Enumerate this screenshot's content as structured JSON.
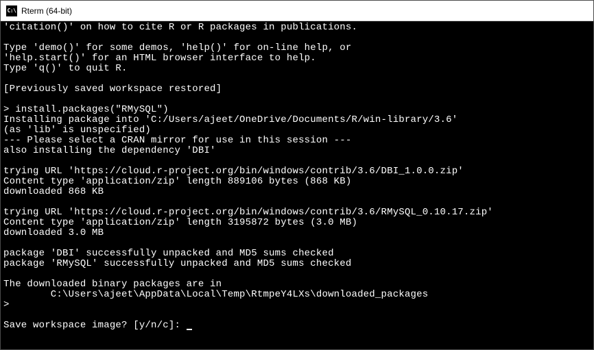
{
  "window": {
    "title": "Rterm (64-bit)",
    "icon_label": "C:\\"
  },
  "terminal": {
    "lines": [
      "'citation()' on how to cite R or R packages in publications.",
      "",
      "Type 'demo()' for some demos, 'help()' for on-line help, or",
      "'help.start()' for an HTML browser interface to help.",
      "Type 'q()' to quit R.",
      "",
      "[Previously saved workspace restored]",
      "",
      "> install.packages(\"RMySQL\")",
      "Installing package into 'C:/Users/ajeet/OneDrive/Documents/R/win-library/3.6'",
      "(as 'lib' is unspecified)",
      "--- Please select a CRAN mirror for use in this session ---",
      "also installing the dependency 'DBI'",
      "",
      "trying URL 'https://cloud.r-project.org/bin/windows/contrib/3.6/DBI_1.0.0.zip'",
      "Content type 'application/zip' length 889106 bytes (868 KB)",
      "downloaded 868 KB",
      "",
      "trying URL 'https://cloud.r-project.org/bin/windows/contrib/3.6/RMySQL_0.10.17.zip'",
      "Content type 'application/zip' length 3195872 bytes (3.0 MB)",
      "downloaded 3.0 MB",
      "",
      "package 'DBI' successfully unpacked and MD5 sums checked",
      "package 'RMySQL' successfully unpacked and MD5 sums checked",
      "",
      "The downloaded binary packages are in",
      "        C:\\Users\\ajeet\\AppData\\Local\\Temp\\RtmpeY4LXs\\downloaded_packages",
      ">",
      "",
      "Save workspace image? [y/n/c]: "
    ]
  }
}
